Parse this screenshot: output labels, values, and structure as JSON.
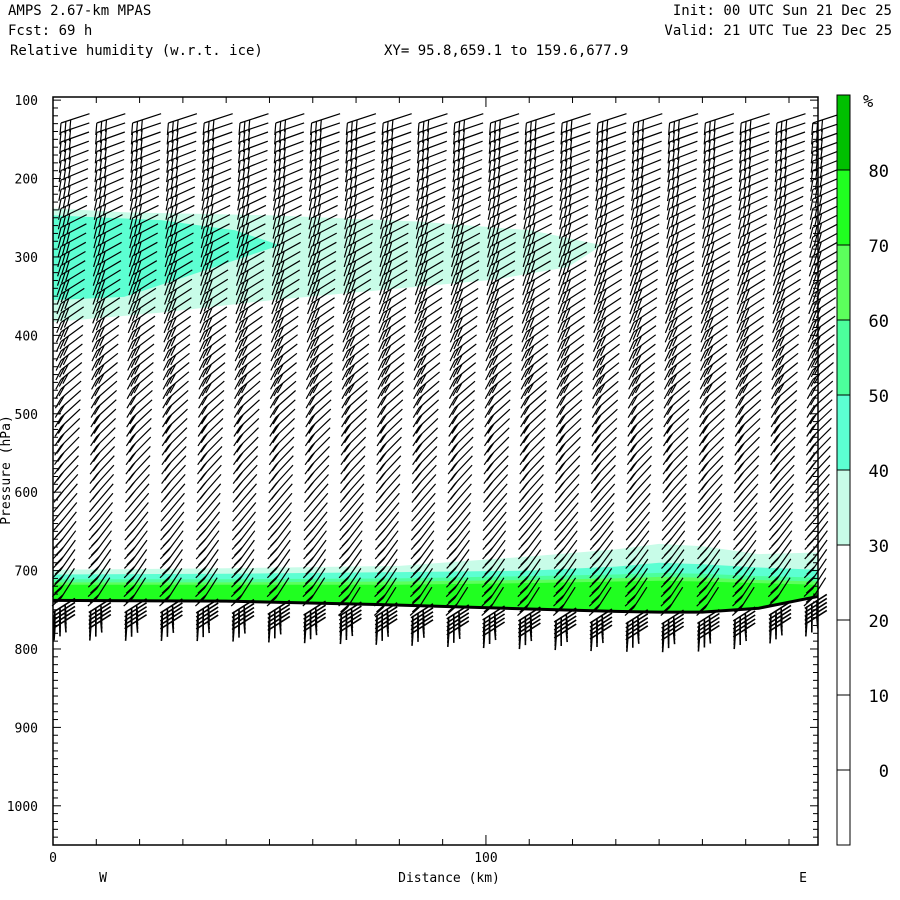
{
  "header": {
    "model": "AMPS 2.67-km MPAS",
    "forecast": "Fcst:   69 h",
    "field": "Relative humidity (w.r.t. ice)",
    "xy": "XY=  95.8,659.1 to 159.6,677.9",
    "init": "Init: 00 UTC Sun 21 Dec 25",
    "valid": "Valid: 21 UTC Tue 23 Dec 25"
  },
  "chart_data": {
    "type": "heatmap",
    "title": "Relative humidity (w.r.t. ice)",
    "xlabel": "Distance (km)",
    "ylabel": "Pressure (hPa)",
    "xlim": [
      0,
      176.7
    ],
    "ylim": [
      1050,
      96
    ],
    "x_ticks": [
      0,
      100
    ],
    "y_ticks": [
      100,
      200,
      300,
      400,
      500,
      600,
      700,
      800,
      900,
      1000
    ],
    "x_end_labels": {
      "left": "W",
      "right": "E"
    },
    "colorbar": {
      "unit": "%",
      "levels": [
        0,
        10,
        20,
        30,
        40,
        50,
        60,
        70,
        80
      ],
      "colors": [
        "#ffffff",
        "#ffffff",
        "#ffffff",
        "#ffffff",
        "#c8fce8",
        "#5cffd2",
        "#4cff9c",
        "#5cff5c",
        "#20ff20",
        "#00c000"
      ]
    },
    "terrain_surface": {
      "km": [
        0,
        40,
        80,
        110,
        130,
        140,
        150,
        163,
        176.7
      ],
      "hPa": [
        738,
        739,
        744,
        749,
        752,
        753,
        753,
        748,
        733
      ]
    },
    "lower_layers": [
      {
        "range": "30-40",
        "color": "#c8fce8",
        "top_hPa": [
          699,
          697,
          694,
          682,
          673,
          666,
          669,
          679,
          677
        ]
      },
      {
        "range": "40-50",
        "color": "#5cffd2",
        "top_hPa": [
          705,
          704,
          702,
          700,
          695,
          690,
          692,
          696,
          699
        ]
      },
      {
        "range": "50-60",
        "color": "#4cff9c",
        "top_hPa": [
          711,
          711,
          710,
          707,
          705,
          703,
          704,
          707,
          709
        ]
      },
      {
        "range": "60-70",
        "color": "#5cff5c",
        "top_hPa": [
          715,
          715,
          714,
          712,
          710,
          708,
          709,
          712,
          714
        ]
      },
      {
        "range": "70-80",
        "color": "#20ff20",
        "top_hPa": [
          718,
          718,
          718,
          716,
          714,
          713,
          714,
          716,
          718
        ]
      }
    ],
    "upper_layers": [
      {
        "range": "30-40",
        "color": "#c8fce8",
        "outline": [
          [
            0,
            238
          ],
          [
            16.4,
            243
          ],
          [
            50.6,
            247
          ],
          [
            84.8,
            255
          ],
          [
            110.4,
            266
          ],
          [
            126.8,
            285
          ],
          [
            118.9,
            313
          ],
          [
            101.8,
            329
          ],
          [
            76.2,
            342
          ],
          [
            50.6,
            355
          ],
          [
            24.9,
            371
          ],
          [
            0,
            383
          ]
        ]
      },
      {
        "range": "40-50",
        "color": "#5cffd2",
        "outline": [
          [
            0,
            247
          ],
          [
            24.9,
            253
          ],
          [
            42,
            266
          ],
          [
            52.4,
            285
          ],
          [
            33.5,
            320
          ],
          [
            16.4,
            351
          ],
          [
            0,
            355
          ]
        ]
      }
    ],
    "wind_barbs": "overlaid at regular columns along the section"
  }
}
